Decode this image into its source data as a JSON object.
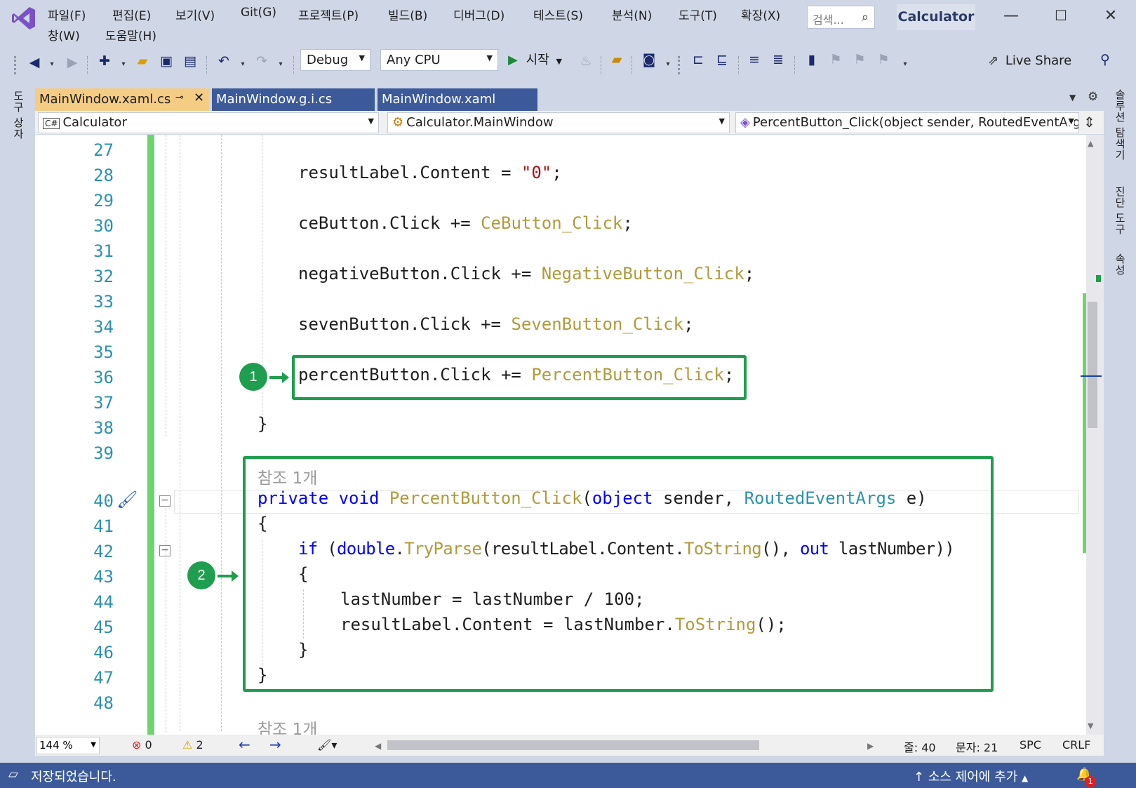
{
  "menu": {
    "items": [
      "파일(F)",
      "편집(E)",
      "보기(V)",
      "Git(G)",
      "프로젝트(P)",
      "빌드(B)",
      "디버그(D)",
      "테스트(S)",
      "분석(N)",
      "도구(T)",
      "확장(X)",
      "창(W)",
      "도움말(H)"
    ]
  },
  "search": {
    "placeholder": "검색..."
  },
  "window": {
    "title": "Calculator"
  },
  "toolbar": {
    "config": "Debug",
    "platform": "Any CPU",
    "start_label": "시작",
    "live_share": "Live Share"
  },
  "side_panels": {
    "left": "도구 상자",
    "right_1": "솔루션 탐색기",
    "right_2": "진단 도구",
    "right_3": "속성"
  },
  "tabs": [
    {
      "label": "MainWindow.xaml.cs",
      "active": true
    },
    {
      "label": "MainWindow.g.i.cs",
      "active": false
    },
    {
      "label": "MainWindow.xaml",
      "active": false
    }
  ],
  "navbar": {
    "project": "Calculator",
    "class": "Calculator.MainWindow",
    "member": "PercentButton_Click(object sender, RoutedEventArgs"
  },
  "code": {
    "line_numbers": [
      "27",
      "28",
      "29",
      "30",
      "31",
      "32",
      "33",
      "34",
      "35",
      "36",
      "37",
      "38",
      "39",
      "40",
      "41",
      "42",
      "43",
      "44",
      "45",
      "46",
      "47",
      "48"
    ],
    "l28": {
      "a": "resultLabel.Content = ",
      "b": "\"0\"",
      "c": ";"
    },
    "l30": {
      "a": "ceButton.Click += ",
      "b": "CeButton_Click",
      "c": ";"
    },
    "l32": {
      "a": "negativeButton.Click += ",
      "b": "NegativeButton_Click",
      "c": ";"
    },
    "l34": {
      "a": "sevenButton.Click += ",
      "b": "SevenButton_Click",
      "c": ";"
    },
    "l36": {
      "a": "percentButton.Click += ",
      "b": "PercentButton_Click",
      "c": ";"
    },
    "l38": "}",
    "ref_count": "참조 1개",
    "l40": {
      "kw1": "private",
      "kw2": "void",
      "name": "PercentButton_Click",
      "p1": "(",
      "kw3": "object",
      "p2": " sender, ",
      "ty": "RoutedEventArgs",
      "p3": " e)"
    },
    "l41": "{",
    "l42": {
      "kw": "if",
      "p1": " (",
      "kw2": "double",
      "p2": ".",
      "m1": "TryParse",
      "p3": "(resultLabel.Content.",
      "m2": "ToString",
      "p4": "(), ",
      "kw3": "out",
      "p5": " lastNumber))"
    },
    "l43": "{",
    "l44": "lastNumber = lastNumber / 100;",
    "l45": {
      "a": "resultLabel.Content = lastNumber.",
      "m": "ToString",
      "c": "();"
    },
    "l46": "}",
    "l47": "}",
    "ref_count_2": "참조 1개"
  },
  "callouts": [
    "1",
    "2"
  ],
  "editor_status": {
    "zoom": "144 %",
    "errors": "0",
    "warnings": "2",
    "line": "줄: 40",
    "col": "문자: 21",
    "spc": "SPC",
    "crlf": "CRLF"
  },
  "statusbar": {
    "message": "저장되었습니다.",
    "source_control": "소스 제어에 추가",
    "notifications": "1"
  },
  "colors": {
    "accent": "#3c5a99",
    "highlight": "#1e9e4e",
    "active_tab": "#f5cc84",
    "change_bar": "#6fd46f"
  }
}
